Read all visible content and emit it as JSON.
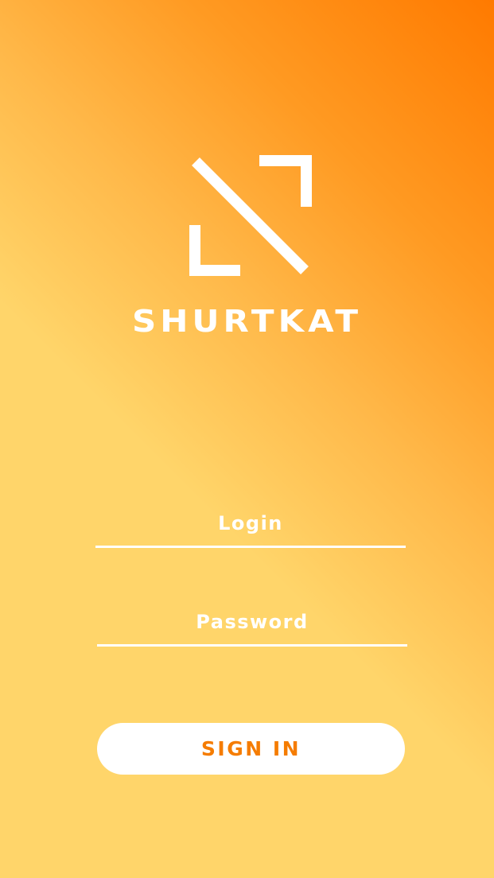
{
  "brand": {
    "logo_icon": "shortcut-arrow-logo-icon",
    "name": "SHURTKAT"
  },
  "form": {
    "login_placeholder": "Login",
    "password_placeholder": "Password",
    "signin_label": "SIGN IN"
  },
  "colors": {
    "gradient_top": "#ff7a00",
    "gradient_bottom": "#ffd56a",
    "button_text": "#f57c00",
    "white": "#ffffff"
  }
}
